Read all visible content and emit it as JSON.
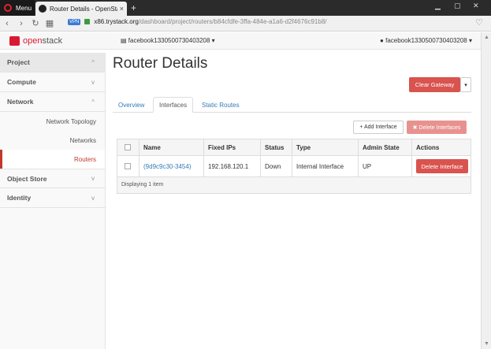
{
  "browser": {
    "menu_label": "Menu",
    "tab_title": "Router Details - OpenStack",
    "tab_close": "×",
    "new_tab": "+",
    "url_host": "x86.trystack.org",
    "url_path": "/dashboard/project/routers/b84cfdfe-3ffa-484e-a1a6-d2f4676c91b8/",
    "vpn_badge": "VPN"
  },
  "header": {
    "logo_open": "open",
    "logo_stack": "stack",
    "project_selector": "facebook1330500730403208 ▾",
    "user_menu": "facebook1330500730403208 ▾"
  },
  "sidebar": {
    "project": "Project",
    "compute": "Compute",
    "network": "Network",
    "network_items": [
      "Network Topology",
      "Networks",
      "Routers"
    ],
    "object_store": "Object Store",
    "identity": "Identity",
    "chev_up": "^",
    "chev_down": "v"
  },
  "main": {
    "title": "Router Details",
    "clear_gateway": "Clear Gateway",
    "caret": "▾",
    "tabs": [
      "Overview",
      "Interfaces",
      "Static Routes"
    ],
    "add_interface": "+ Add Interface",
    "delete_interfaces": "✖ Delete Interfaces"
  },
  "table": {
    "columns": [
      "Name",
      "Fixed IPs",
      "Status",
      "Type",
      "Admin State",
      "Actions"
    ],
    "rows": [
      {
        "name": "(9d9c9c30-3454)",
        "fixed_ips": "192.168.120.1",
        "status": "Down",
        "type": "Internal Interface",
        "admin_state": "UP",
        "action": "Delete Interface"
      }
    ],
    "footer": "Displaying 1 item"
  },
  "colors": {
    "brand": "#da1a32",
    "danger": "#d9534f",
    "link": "#337ab7"
  }
}
